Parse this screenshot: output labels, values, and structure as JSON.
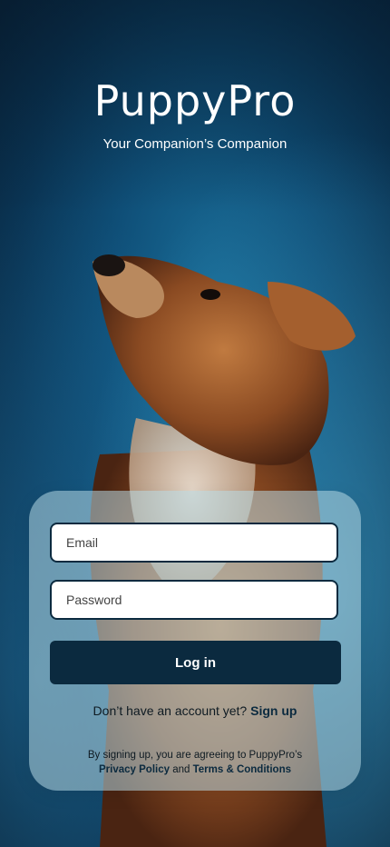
{
  "app": {
    "name": "PuppyPro",
    "tagline": "Your Companion’s Companion"
  },
  "form": {
    "email_placeholder": "Email",
    "email_value": "",
    "password_placeholder": "Password",
    "password_value": "",
    "login_label": "Log in"
  },
  "signup": {
    "prompt": "Don’t have an account yet?",
    "link_label": "Sign up"
  },
  "legal": {
    "text": "By signing up, you are agreeing to PuppyPro’s",
    "privacy_label": "Privacy Policy",
    "and": "and",
    "terms_label": "Terms & Conditions"
  },
  "colors": {
    "primary": "#0b2a3f",
    "background": "#0f4f78",
    "card": "#b4d7e1"
  }
}
